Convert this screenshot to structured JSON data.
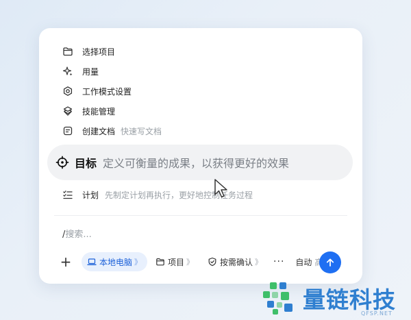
{
  "menu": {
    "items": [
      {
        "label": "选择项目",
        "icon": "folder-icon"
      },
      {
        "label": "用量",
        "icon": "sparkle-icon"
      },
      {
        "label": "工作模式设置",
        "icon": "gear-icon"
      },
      {
        "label": "技能管理",
        "icon": "layers-icon"
      },
      {
        "label": "创建文档",
        "hint": "快速写文档",
        "icon": "document-icon"
      }
    ]
  },
  "goal": {
    "label": "目标",
    "hint": "定义可衡量的成果，以获得更好的效果",
    "icon": "target-icon"
  },
  "plan": {
    "label": "计划",
    "hint": "先制定计划再执行，更好地控制任务过程",
    "icon": "checklist-icon"
  },
  "search": {
    "prefix": "/",
    "placeholder": "搜索..."
  },
  "toolbar": {
    "add": "+",
    "local": "本地电脑",
    "project": "项目",
    "confirm": "按需确认",
    "more": "···",
    "mode": "自动",
    "mode_level": "高",
    "chevron": "》"
  },
  "watermark": {
    "brand": "量链科技",
    "domain": "QFSP.NET"
  },
  "colors": {
    "accent": "#1f6ff2",
    "brand": "#2f7fd0",
    "logo_green": "#3fbf6a"
  }
}
